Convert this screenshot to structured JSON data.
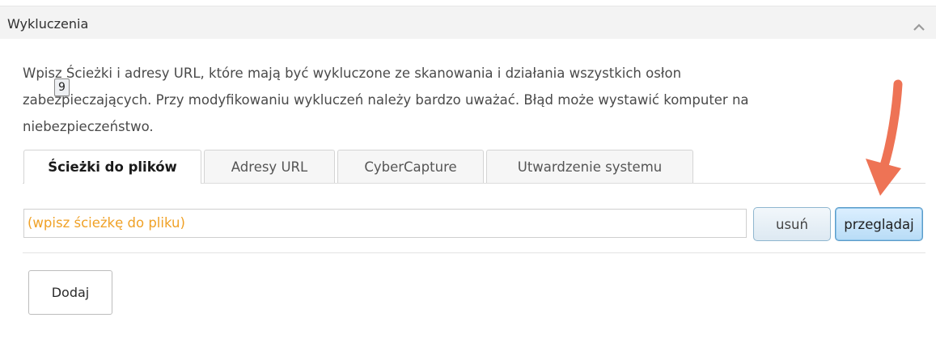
{
  "section": {
    "title": "Wykluczenia",
    "collapse_icon": "chevron-up-icon"
  },
  "description": {
    "lines": [
      "Wpisz Ścieżki i adresy URL, które mają być wykluczone ze skanowania i działania wszystkich osłon",
      "zabezpieczających. Przy modyfikowaniu wykluczeń należy bardzo uważać. Błąd może wystawić komputer na",
      "niebezpieczeństwo."
    ]
  },
  "tooltip_badge": "9",
  "tabs": [
    {
      "label": "Ścieżki do plików",
      "active": true
    },
    {
      "label": "Adresy URL",
      "active": false
    },
    {
      "label": "CyberCapture",
      "active": false
    },
    {
      "label": "Utwardzenie systemu",
      "active": false
    }
  ],
  "path_input": {
    "placeholder": "(wpisz ścieżkę do pliku)",
    "value": ""
  },
  "buttons": {
    "remove": "usuń",
    "browse": "przeglądaj",
    "add": "Dodaj"
  },
  "annotation": {
    "icon": "arrow-down-icon",
    "color": "#ee7355"
  },
  "colors": {
    "header_bg": "#f3f3f3",
    "placeholder": "#f0a126",
    "browse_bg": "#b8dcf6"
  }
}
